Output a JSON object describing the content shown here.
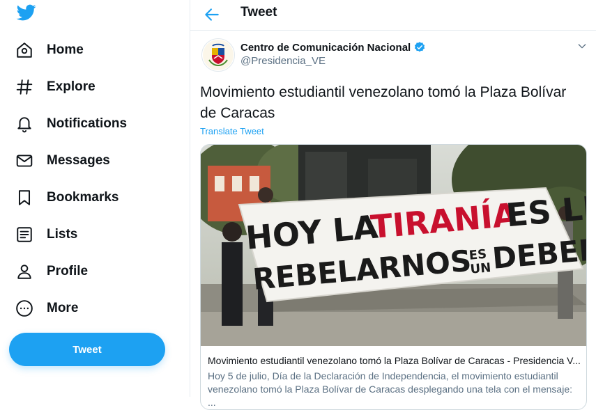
{
  "sidebar": {
    "logo_icon": "twitter-bird-icon",
    "items": [
      {
        "label": "Home",
        "icon": "home-icon"
      },
      {
        "label": "Explore",
        "icon": "hashtag-icon"
      },
      {
        "label": "Notifications",
        "icon": "bell-icon"
      },
      {
        "label": "Messages",
        "icon": "envelope-icon"
      },
      {
        "label": "Bookmarks",
        "icon": "bookmark-icon"
      },
      {
        "label": "Lists",
        "icon": "list-icon"
      },
      {
        "label": "Profile",
        "icon": "person-icon"
      },
      {
        "label": "More",
        "icon": "more-circle-icon"
      }
    ],
    "tweet_button": "Tweet"
  },
  "header": {
    "title": "Tweet",
    "back_icon": "back-arrow-icon"
  },
  "tweet": {
    "author_name": "Centro de Comunicación Nacional",
    "handle": "@Presidencia_VE",
    "text": "Movimiento estudiantil venezolano tomó la Plaza Bolívar de Caracas",
    "translate": "Translate Tweet",
    "card": {
      "banner_line1_a": "HOY LA",
      "banner_line1_b": "TIRANÍA",
      "banner_line1_c": "ES LEY",
      "banner_line2_a": "REBELARNOS",
      "banner_line2_b": "ES",
      "banner_line2_c": "UN",
      "banner_line2_d": "DEBER",
      "title": "Movimiento estudiantil venezolano tomó la Plaza Bolívar de Caracas - Presidencia V...",
      "description": "Hoy 5 de julio, Día de la Declaración de Independencia, el movimiento estudiantil venezolano tomó la Plaza Bolívar de Caracas desplegando una tela con el mensaje: ..."
    }
  },
  "colors": {
    "accent": "#1da1f2",
    "text": "#0f1419",
    "muted": "#5b7083",
    "banner_red": "#c8102e"
  }
}
